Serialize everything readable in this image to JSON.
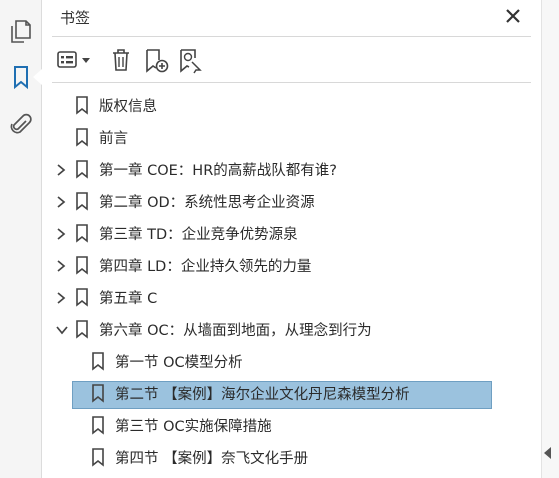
{
  "panel": {
    "title": "书签"
  },
  "bookmarks": [
    {
      "label": "版权信息",
      "expandable": false,
      "expanded": false,
      "level": 0
    },
    {
      "label": "前言",
      "expandable": false,
      "expanded": false,
      "level": 0
    },
    {
      "label": "第一章 COE：HR的高薪战队都有谁?",
      "expandable": true,
      "expanded": false,
      "level": 0
    },
    {
      "label": "第二章 OD：系统性思考企业资源",
      "expandable": true,
      "expanded": false,
      "level": 0
    },
    {
      "label": "第三章 TD：企业竞争优势源泉",
      "expandable": true,
      "expanded": false,
      "level": 0
    },
    {
      "label": "第四章 LD：企业持久领先的力量",
      "expandable": true,
      "expanded": false,
      "level": 0
    },
    {
      "label": "第五章 C",
      "expandable": true,
      "expanded": false,
      "level": 0
    },
    {
      "label": "第六章 OC：从墙面到地面，从理念到行为",
      "expandable": true,
      "expanded": true,
      "level": 0
    },
    {
      "label": "第一节 OC模型分析",
      "expandable": false,
      "expanded": false,
      "level": 1
    },
    {
      "label": "第二节 【案例】海尔企业文化丹尼森模型分析",
      "expandable": false,
      "expanded": false,
      "level": 1,
      "selected": true
    },
    {
      "label": "第三节 OC实施保障措施",
      "expandable": false,
      "expanded": false,
      "level": 1
    },
    {
      "label": "第四节 【案例】奈飞文化手册",
      "expandable": false,
      "expanded": false,
      "level": 1
    }
  ],
  "colors": {
    "selection": "#9bc2de",
    "accent": "#1f6fb2"
  }
}
